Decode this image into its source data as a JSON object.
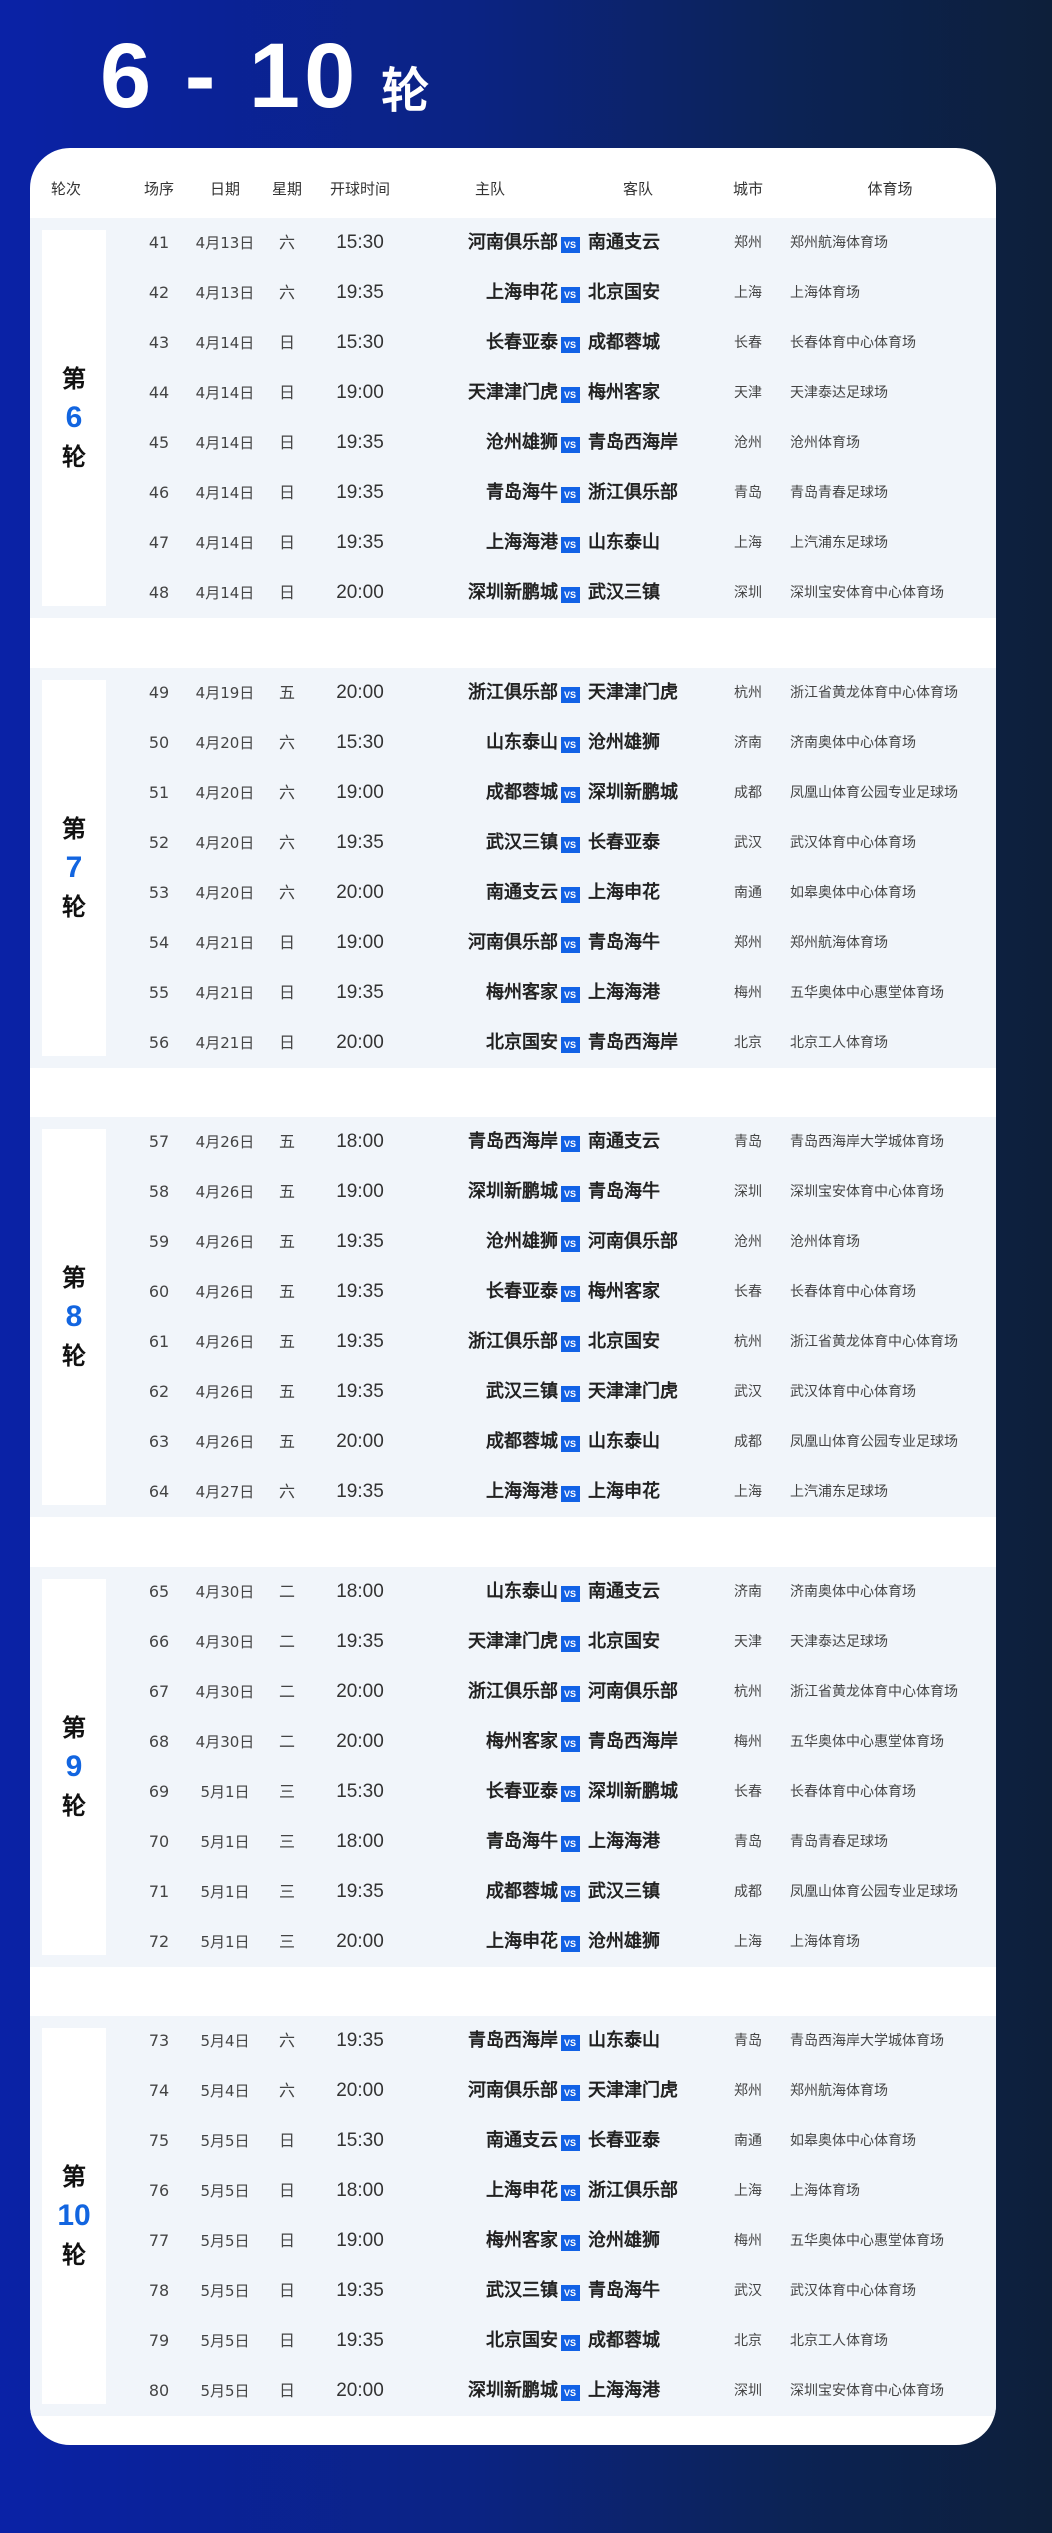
{
  "title": {
    "range": "6 - 10",
    "suffix": "轮"
  },
  "colors": {
    "accent": "#1265e0",
    "vs_badge": "#1262e6",
    "band": "#f1f5fa",
    "bg_left": "#0a22a6",
    "bg_right": "#0d1f3a"
  },
  "headers": {
    "round": "轮次",
    "no": "场序",
    "date": "日期",
    "week": "星期",
    "time": "开球时间",
    "home": "主队",
    "away": "客队",
    "city": "城市",
    "venue": "体育场"
  },
  "vs_label": "VS",
  "rounds": [
    {
      "prefix": "第",
      "number": "6",
      "suffix": "轮",
      "matches": [
        {
          "no": "41",
          "date": "4月13日",
          "week": "六",
          "time": "15:30",
          "home": "河南俱乐部",
          "away": "南通支云",
          "city": "郑州",
          "venue": "郑州航海体育场"
        },
        {
          "no": "42",
          "date": "4月13日",
          "week": "六",
          "time": "19:35",
          "home": "上海申花",
          "away": "北京国安",
          "city": "上海",
          "venue": "上海体育场"
        },
        {
          "no": "43",
          "date": "4月14日",
          "week": "日",
          "time": "15:30",
          "home": "长春亚泰",
          "away": "成都蓉城",
          "city": "长春",
          "venue": "长春体育中心体育场"
        },
        {
          "no": "44",
          "date": "4月14日",
          "week": "日",
          "time": "19:00",
          "home": "天津津门虎",
          "away": "梅州客家",
          "city": "天津",
          "venue": "天津泰达足球场"
        },
        {
          "no": "45",
          "date": "4月14日",
          "week": "日",
          "time": "19:35",
          "home": "沧州雄狮",
          "away": "青岛西海岸",
          "city": "沧州",
          "venue": "沧州体育场"
        },
        {
          "no": "46",
          "date": "4月14日",
          "week": "日",
          "time": "19:35",
          "home": "青岛海牛",
          "away": "浙江俱乐部",
          "city": "青岛",
          "venue": "青岛青春足球场"
        },
        {
          "no": "47",
          "date": "4月14日",
          "week": "日",
          "time": "19:35",
          "home": "上海海港",
          "away": "山东泰山",
          "city": "上海",
          "venue": "上汽浦东足球场"
        },
        {
          "no": "48",
          "date": "4月14日",
          "week": "日",
          "time": "20:00",
          "home": "深圳新鹏城",
          "away": "武汉三镇",
          "city": "深圳",
          "venue": "深圳宝安体育中心体育场"
        }
      ]
    },
    {
      "prefix": "第",
      "number": "7",
      "suffix": "轮",
      "matches": [
        {
          "no": "49",
          "date": "4月19日",
          "week": "五",
          "time": "20:00",
          "home": "浙江俱乐部",
          "away": "天津津门虎",
          "city": "杭州",
          "venue": "浙江省黄龙体育中心体育场"
        },
        {
          "no": "50",
          "date": "4月20日",
          "week": "六",
          "time": "15:30",
          "home": "山东泰山",
          "away": "沧州雄狮",
          "city": "济南",
          "venue": "济南奥体中心体育场"
        },
        {
          "no": "51",
          "date": "4月20日",
          "week": "六",
          "time": "19:00",
          "home": "成都蓉城",
          "away": "深圳新鹏城",
          "city": "成都",
          "venue": "凤凰山体育公园专业足球场"
        },
        {
          "no": "52",
          "date": "4月20日",
          "week": "六",
          "time": "19:35",
          "home": "武汉三镇",
          "away": "长春亚泰",
          "city": "武汉",
          "venue": "武汉体育中心体育场"
        },
        {
          "no": "53",
          "date": "4月20日",
          "week": "六",
          "time": "20:00",
          "home": "南通支云",
          "away": "上海申花",
          "city": "南通",
          "venue": "如皋奥体中心体育场"
        },
        {
          "no": "54",
          "date": "4月21日",
          "week": "日",
          "time": "19:00",
          "home": "河南俱乐部",
          "away": "青岛海牛",
          "city": "郑州",
          "venue": "郑州航海体育场"
        },
        {
          "no": "55",
          "date": "4月21日",
          "week": "日",
          "time": "19:35",
          "home": "梅州客家",
          "away": "上海海港",
          "city": "梅州",
          "venue": "五华奥体中心惠堂体育场"
        },
        {
          "no": "56",
          "date": "4月21日",
          "week": "日",
          "time": "20:00",
          "home": "北京国安",
          "away": "青岛西海岸",
          "city": "北京",
          "venue": "北京工人体育场"
        }
      ]
    },
    {
      "prefix": "第",
      "number": "8",
      "suffix": "轮",
      "matches": [
        {
          "no": "57",
          "date": "4月26日",
          "week": "五",
          "time": "18:00",
          "home": "青岛西海岸",
          "away": "南通支云",
          "city": "青岛",
          "venue": "青岛西海岸大学城体育场"
        },
        {
          "no": "58",
          "date": "4月26日",
          "week": "五",
          "time": "19:00",
          "home": "深圳新鹏城",
          "away": "青岛海牛",
          "city": "深圳",
          "venue": "深圳宝安体育中心体育场"
        },
        {
          "no": "59",
          "date": "4月26日",
          "week": "五",
          "time": "19:35",
          "home": "沧州雄狮",
          "away": "河南俱乐部",
          "city": "沧州",
          "venue": "沧州体育场"
        },
        {
          "no": "60",
          "date": "4月26日",
          "week": "五",
          "time": "19:35",
          "home": "长春亚泰",
          "away": "梅州客家",
          "city": "长春",
          "venue": "长春体育中心体育场"
        },
        {
          "no": "61",
          "date": "4月26日",
          "week": "五",
          "time": "19:35",
          "home": "浙江俱乐部",
          "away": "北京国安",
          "city": "杭州",
          "venue": "浙江省黄龙体育中心体育场"
        },
        {
          "no": "62",
          "date": "4月26日",
          "week": "五",
          "time": "19:35",
          "home": "武汉三镇",
          "away": "天津津门虎",
          "city": "武汉",
          "venue": "武汉体育中心体育场"
        },
        {
          "no": "63",
          "date": "4月26日",
          "week": "五",
          "time": "20:00",
          "home": "成都蓉城",
          "away": "山东泰山",
          "city": "成都",
          "venue": "凤凰山体育公园专业足球场"
        },
        {
          "no": "64",
          "date": "4月27日",
          "week": "六",
          "time": "19:35",
          "home": "上海海港",
          "away": "上海申花",
          "city": "上海",
          "venue": "上汽浦东足球场"
        }
      ]
    },
    {
      "prefix": "第",
      "number": "9",
      "suffix": "轮",
      "matches": [
        {
          "no": "65",
          "date": "4月30日",
          "week": "二",
          "time": "18:00",
          "home": "山东泰山",
          "away": "南通支云",
          "city": "济南",
          "venue": "济南奥体中心体育场"
        },
        {
          "no": "66",
          "date": "4月30日",
          "week": "二",
          "time": "19:35",
          "home": "天津津门虎",
          "away": "北京国安",
          "city": "天津",
          "venue": "天津泰达足球场"
        },
        {
          "no": "67",
          "date": "4月30日",
          "week": "二",
          "time": "20:00",
          "home": "浙江俱乐部",
          "away": "河南俱乐部",
          "city": "杭州",
          "venue": "浙江省黄龙体育中心体育场"
        },
        {
          "no": "68",
          "date": "4月30日",
          "week": "二",
          "time": "20:00",
          "home": "梅州客家",
          "away": "青岛西海岸",
          "city": "梅州",
          "venue": "五华奥体中心惠堂体育场"
        },
        {
          "no": "69",
          "date": "5月1日",
          "week": "三",
          "time": "15:30",
          "home": "长春亚泰",
          "away": "深圳新鹏城",
          "city": "长春",
          "venue": "长春体育中心体育场"
        },
        {
          "no": "70",
          "date": "5月1日",
          "week": "三",
          "time": "18:00",
          "home": "青岛海牛",
          "away": "上海海港",
          "city": "青岛",
          "venue": "青岛青春足球场"
        },
        {
          "no": "71",
          "date": "5月1日",
          "week": "三",
          "time": "19:35",
          "home": "成都蓉城",
          "away": "武汉三镇",
          "city": "成都",
          "venue": "凤凰山体育公园专业足球场"
        },
        {
          "no": "72",
          "date": "5月1日",
          "week": "三",
          "time": "20:00",
          "home": "上海申花",
          "away": "沧州雄狮",
          "city": "上海",
          "venue": "上海体育场"
        }
      ]
    },
    {
      "prefix": "第",
      "number": "10",
      "suffix": "轮",
      "matches": [
        {
          "no": "73",
          "date": "5月4日",
          "week": "六",
          "time": "19:35",
          "home": "青岛西海岸",
          "away": "山东泰山",
          "city": "青岛",
          "venue": "青岛西海岸大学城体育场"
        },
        {
          "no": "74",
          "date": "5月4日",
          "week": "六",
          "time": "20:00",
          "home": "河南俱乐部",
          "away": "天津津门虎",
          "city": "郑州",
          "venue": "郑州航海体育场"
        },
        {
          "no": "75",
          "date": "5月5日",
          "week": "日",
          "time": "15:30",
          "home": "南通支云",
          "away": "长春亚泰",
          "city": "南通",
          "venue": "如皋奥体中心体育场"
        },
        {
          "no": "76",
          "date": "5月5日",
          "week": "日",
          "time": "18:00",
          "home": "上海申花",
          "away": "浙江俱乐部",
          "city": "上海",
          "venue": "上海体育场"
        },
        {
          "no": "77",
          "date": "5月5日",
          "week": "日",
          "time": "19:00",
          "home": "梅州客家",
          "away": "沧州雄狮",
          "city": "梅州",
          "venue": "五华奥体中心惠堂体育场"
        },
        {
          "no": "78",
          "date": "5月5日",
          "week": "日",
          "time": "19:35",
          "home": "武汉三镇",
          "away": "青岛海牛",
          "city": "武汉",
          "venue": "武汉体育中心体育场"
        },
        {
          "no": "79",
          "date": "5月5日",
          "week": "日",
          "time": "19:35",
          "home": "北京国安",
          "away": "成都蓉城",
          "city": "北京",
          "venue": "北京工人体育场"
        },
        {
          "no": "80",
          "date": "5月5日",
          "week": "日",
          "time": "20:00",
          "home": "深圳新鹏城",
          "away": "上海海港",
          "city": "深圳",
          "venue": "深圳宝安体育中心体育场"
        }
      ]
    }
  ]
}
